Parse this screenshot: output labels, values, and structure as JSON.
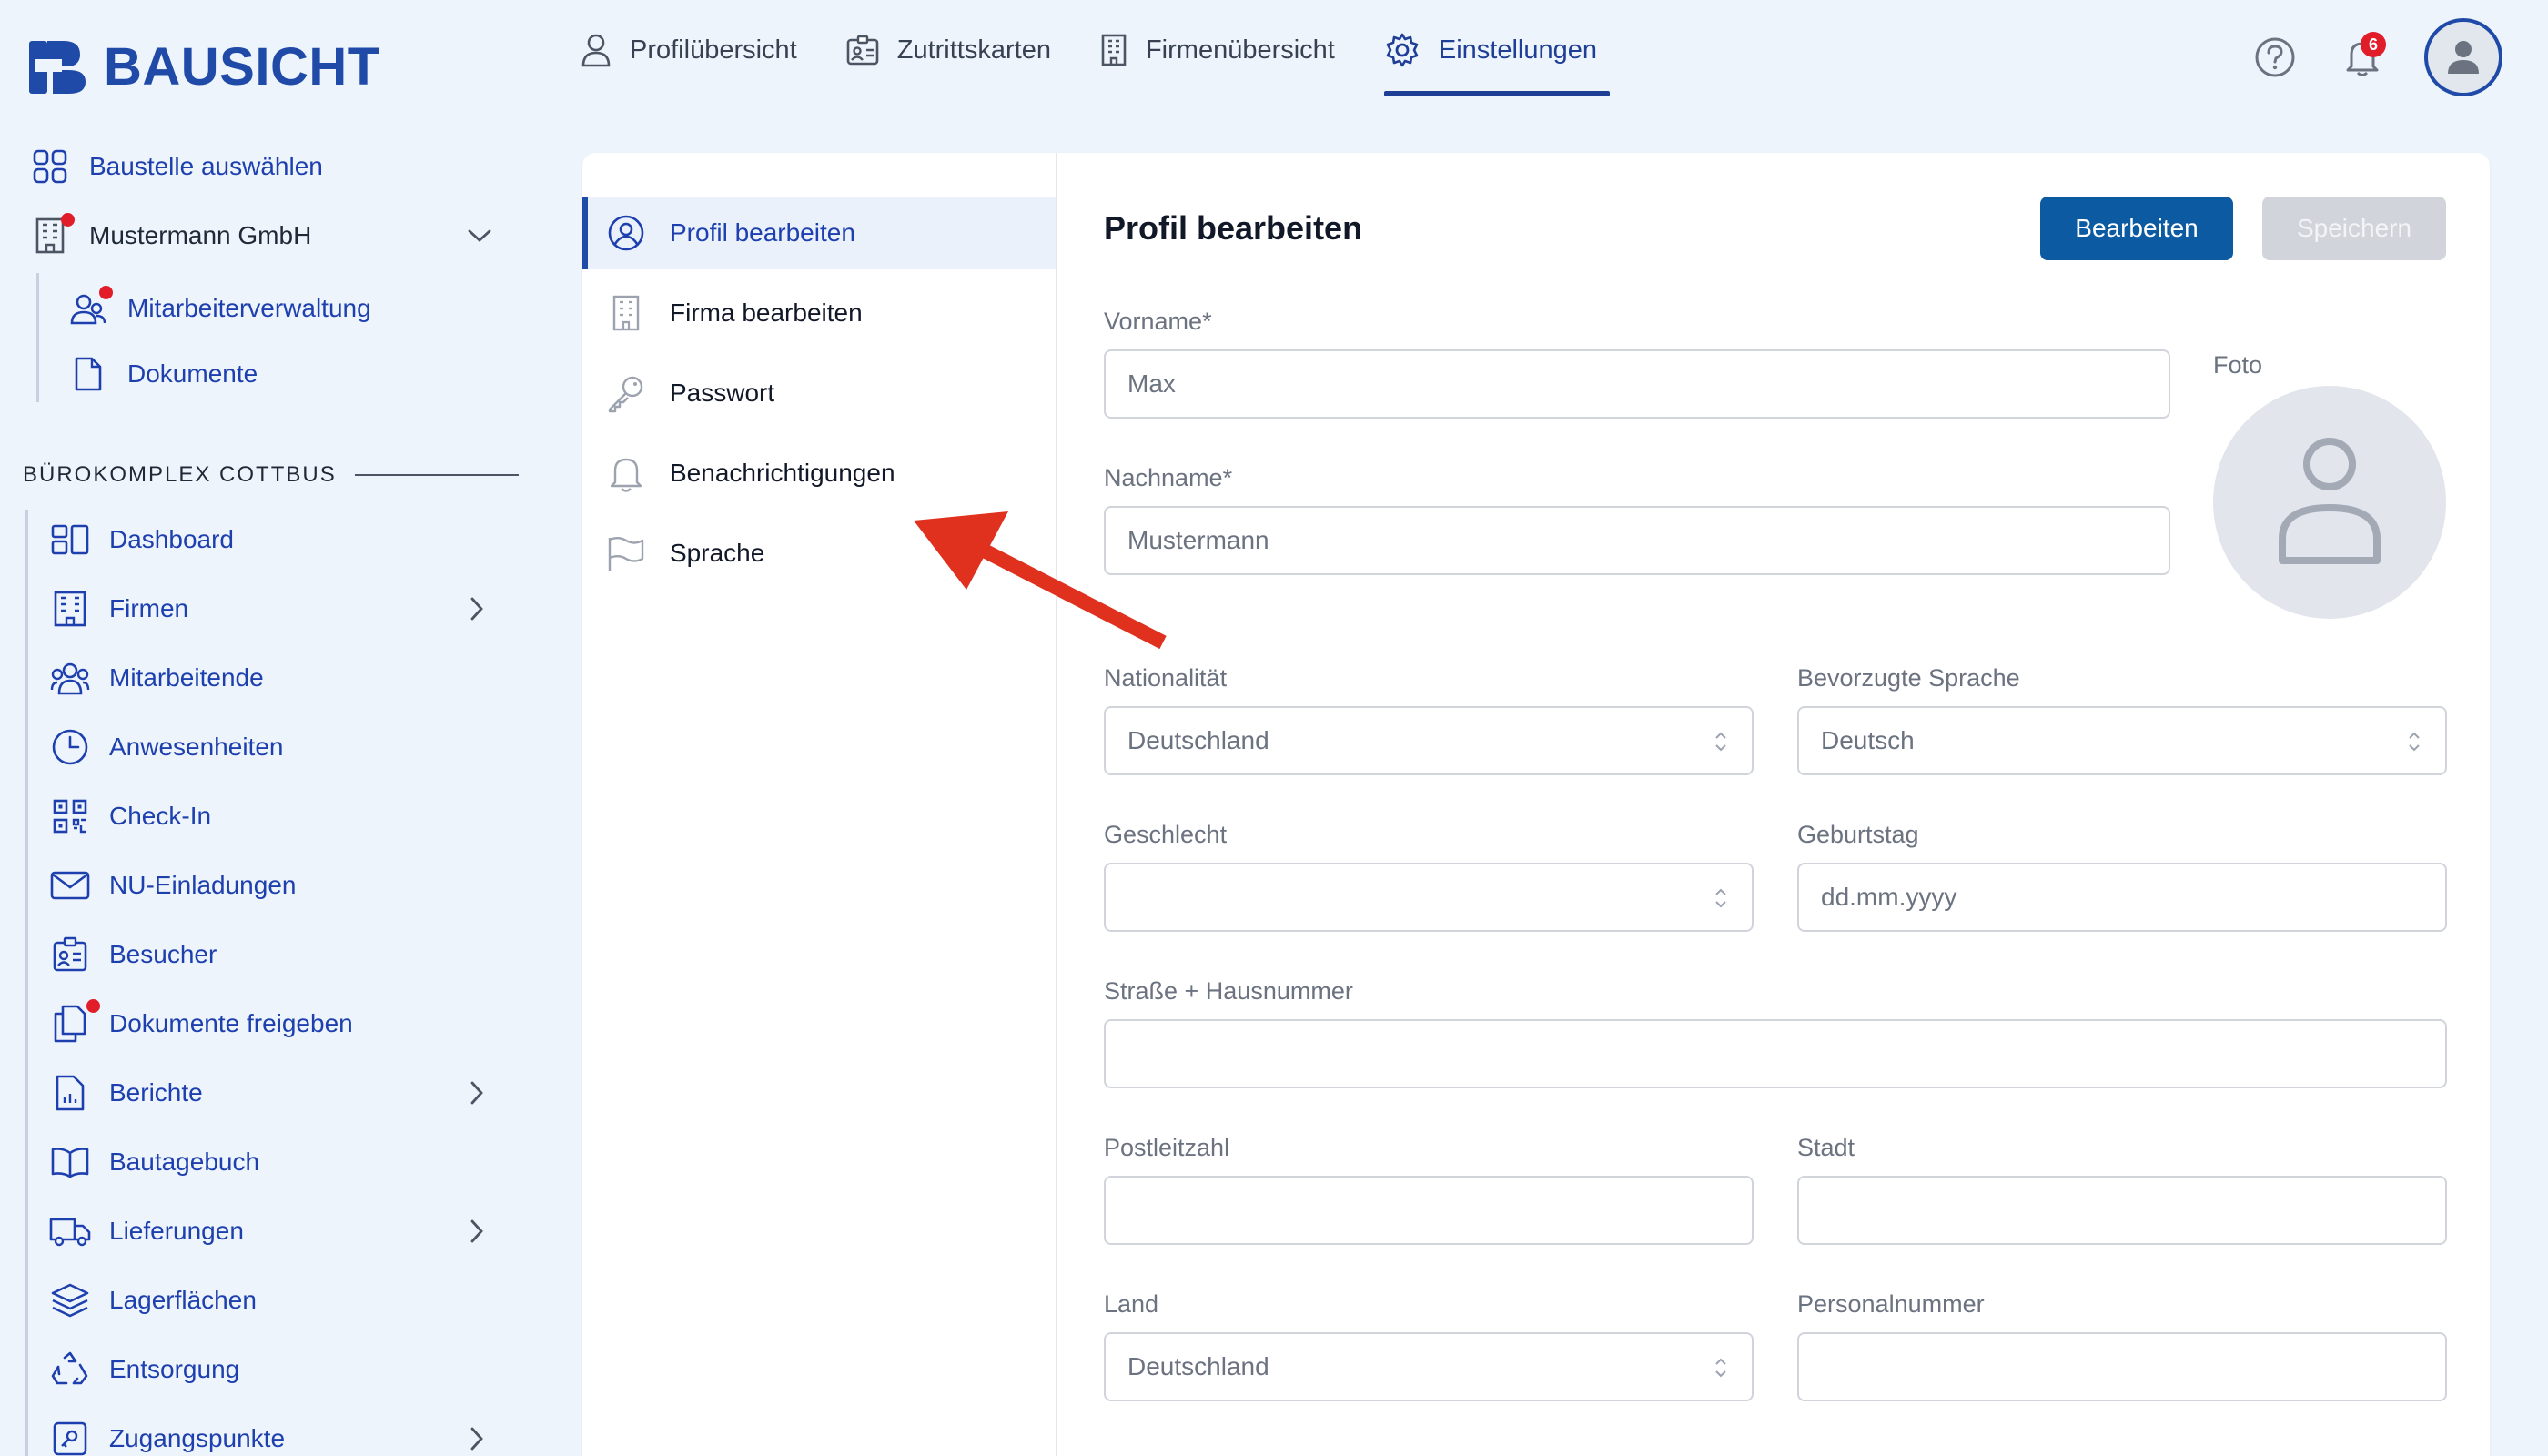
{
  "app": {
    "name": "BAUSICHT"
  },
  "topnav": [
    {
      "label": "Profilübersicht",
      "icon": "person-icon",
      "active": false
    },
    {
      "label": "Zutrittskarten",
      "icon": "id-card-icon",
      "active": false
    },
    {
      "label": "Firmenübersicht",
      "icon": "building-icon",
      "active": false
    },
    {
      "label": "Einstellungen",
      "icon": "gear-icon",
      "active": true
    }
  ],
  "header": {
    "notifications_count": "6"
  },
  "sidebar": {
    "select_site": "Baustelle auswählen",
    "company": "Mustermann GmbH",
    "company_sub": [
      "Mitarbeiterverwaltung",
      "Dokumente"
    ],
    "section_title": "BÜROKOMPLEX COTTBUS",
    "items": [
      {
        "label": "Dashboard",
        "icon": "dashboard-icon"
      },
      {
        "label": "Firmen",
        "icon": "building-icon"
      },
      {
        "label": "Mitarbeitende",
        "icon": "users-icon"
      },
      {
        "label": "Anwesenheiten",
        "icon": "clock-icon"
      },
      {
        "label": "Check-In",
        "icon": "qr-code-icon"
      },
      {
        "label": "NU-Einladungen",
        "icon": "mail-icon"
      },
      {
        "label": "Besucher",
        "icon": "visitor-badge-icon"
      },
      {
        "label": "Dokumente freigeben",
        "icon": "documents-icon"
      },
      {
        "label": "Berichte",
        "icon": "report-icon"
      },
      {
        "label": "Bautagebuch",
        "icon": "book-icon"
      },
      {
        "label": "Lieferungen",
        "icon": "truck-icon"
      },
      {
        "label": "Lagerflächen",
        "icon": "layers-icon"
      },
      {
        "label": "Entsorgung",
        "icon": "recycle-icon"
      },
      {
        "label": "Zugangspunkte",
        "icon": "access-point-icon"
      }
    ]
  },
  "settings_menu": [
    {
      "label": "Profil bearbeiten",
      "icon": "user-circle-icon",
      "active": true
    },
    {
      "label": "Firma bearbeiten",
      "icon": "building-icon",
      "active": false
    },
    {
      "label": "Passwort",
      "icon": "key-icon",
      "active": false
    },
    {
      "label": "Benachrichtigungen",
      "icon": "bell-icon",
      "active": false
    },
    {
      "label": "Sprache",
      "icon": "flag-icon",
      "active": false
    }
  ],
  "form": {
    "title": "Profil bearbeiten",
    "edit_button": "Bearbeiten",
    "save_button": "Speichern",
    "photo_label": "Foto",
    "fields": {
      "vorname": {
        "label": "Vorname*",
        "value": "Max"
      },
      "nachname": {
        "label": "Nachname*",
        "value": "Mustermann"
      },
      "nationalitaet": {
        "label": "Nationalität",
        "value": "Deutschland"
      },
      "sprache": {
        "label": "Bevorzugte Sprache",
        "value": "Deutsch"
      },
      "geschlecht": {
        "label": "Geschlecht",
        "value": ""
      },
      "geburtstag": {
        "label": "Geburtstag",
        "placeholder": "dd.mm.yyyy"
      },
      "strasse": {
        "label": "Straße + Hausnummer",
        "value": ""
      },
      "plz": {
        "label": "Postleitzahl",
        "value": ""
      },
      "stadt": {
        "label": "Stadt",
        "value": ""
      },
      "land": {
        "label": "Land",
        "value": "Deutschland"
      },
      "personalnummer": {
        "label": "Personalnummer",
        "value": ""
      }
    }
  },
  "colors": {
    "brand": "#1f4aa8",
    "primary_button": "#0b5aa2",
    "annotation_arrow": "#e0301e",
    "badge": "#e11d2a"
  }
}
